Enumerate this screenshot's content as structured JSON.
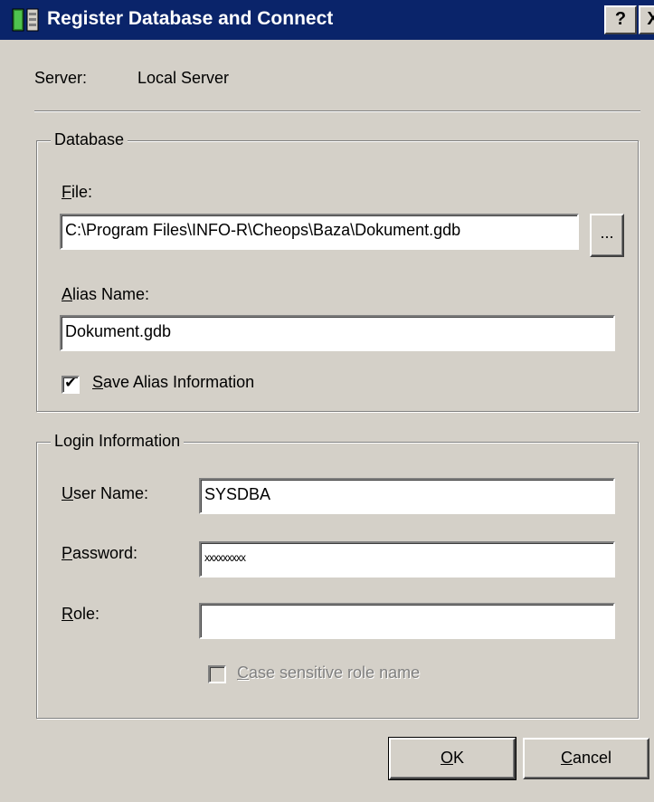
{
  "window": {
    "title": "Register Database and Connect",
    "help_label": "?",
    "close_label": "X"
  },
  "server": {
    "label": "Server:",
    "value": "Local Server"
  },
  "database": {
    "legend": "Database",
    "file_label_accel": "F",
    "file_label_rest": "ile:",
    "file_value": "C:\\Program Files\\INFO-R\\Cheops\\Baza\\Dokument.gdb",
    "browse_label": "...",
    "alias_label_accel": "A",
    "alias_label_rest": "lias Name:",
    "alias_value": "Dokument.gdb",
    "save_alias_checked": true,
    "save_alias_accel": "S",
    "save_alias_rest": "ave Alias Information"
  },
  "login": {
    "legend": "Login Information",
    "user_label_accel": "U",
    "user_label_rest": "ser Name:",
    "user_value": "SYSDBA",
    "password_label_accel": "P",
    "password_label_rest": "assword:",
    "password_value": "xxxxxxxxx",
    "role_label_accel": "R",
    "role_label_rest": "ole:",
    "role_value": "",
    "case_checked": false,
    "case_accel": "C",
    "case_rest": "ase sensitive role name"
  },
  "buttons": {
    "ok_accel": "O",
    "ok_rest": "K",
    "cancel_accel": "C",
    "cancel_rest": "ancel"
  },
  "colors": {
    "titlebar": "#0a246a",
    "face": "#d4d0c8"
  }
}
